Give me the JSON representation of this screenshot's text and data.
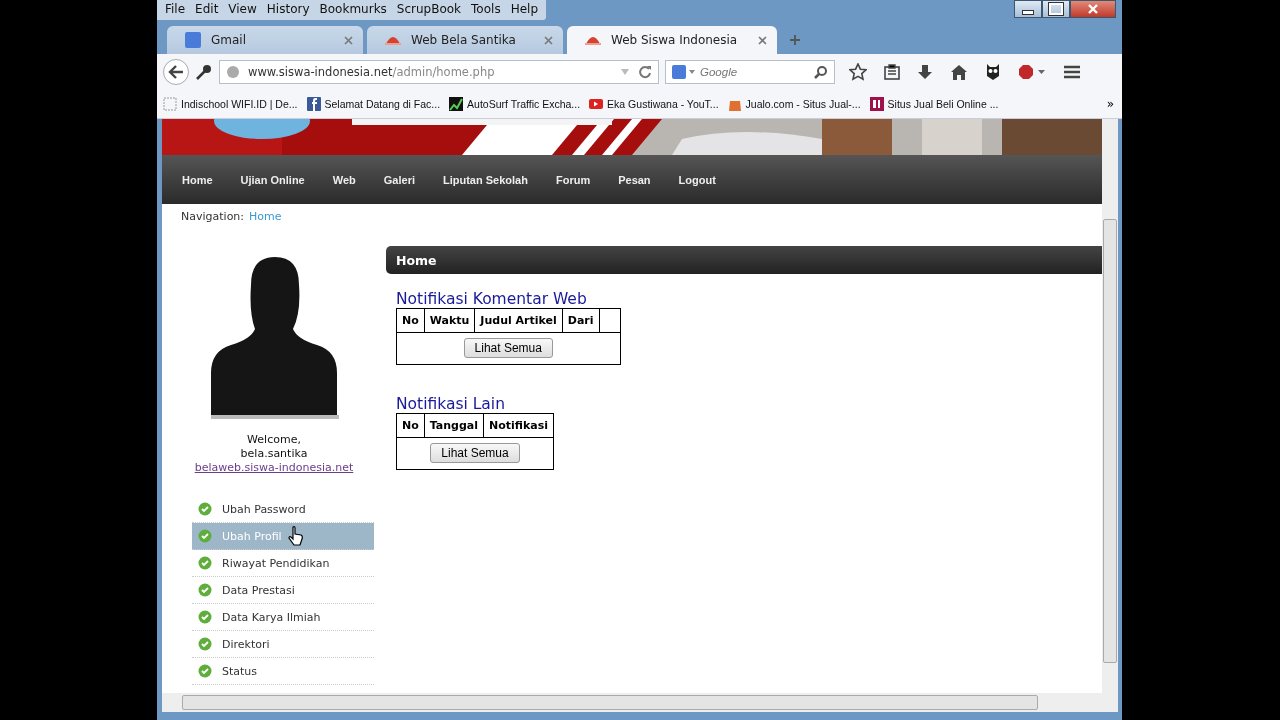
{
  "menu_bar": [
    "File",
    "Edit",
    "View",
    "History",
    "Bookmurks",
    "ScrupBook",
    "Tools",
    "Help"
  ],
  "tabs": [
    {
      "label": "Gmail",
      "kind": "google",
      "selected": false
    },
    {
      "label": "Web Bela Santika",
      "kind": "site",
      "selected": false
    },
    {
      "label": "Web Siswa Indonesia",
      "kind": "site",
      "selected": true
    }
  ],
  "address_bar": {
    "domain": "www.siswa-indonesia.net",
    "path": "/admin/home.php"
  },
  "search": {
    "placeholder": "Google"
  },
  "bookmarks": [
    {
      "label": "Indischool WIFI.ID | De...",
      "kind": "blank"
    },
    {
      "label": "Selamat Datang di Fac...",
      "kind": "facebook"
    },
    {
      "label": "AutoSurf Traffic Excha...",
      "kind": "chart"
    },
    {
      "label": "Eka Gustiwana - YouT...",
      "kind": "youtube"
    },
    {
      "label": "Jualo.com - Situs Jual-...",
      "kind": "bag"
    },
    {
      "label": "Situs Jual Beli Online ...",
      "kind": "square"
    }
  ],
  "bookmarks_overflow": "»",
  "site_nav": [
    {
      "label": "Home"
    },
    {
      "label": "Ujian Online"
    },
    {
      "label": "Web"
    },
    {
      "label": "Galeri"
    },
    {
      "label": "Liputan Sekolah"
    },
    {
      "label": "Forum"
    },
    {
      "label": "Pesan"
    },
    {
      "label": "Logout"
    }
  ],
  "breadcrumb": {
    "label": "Navigation:",
    "current": "Home"
  },
  "profile": {
    "welcome": "Welcome,",
    "username": "bela.santika",
    "link": "belaweb.siswa-indonesia.net"
  },
  "sidebar_items": [
    {
      "label": "Ubah Password",
      "selected": false
    },
    {
      "label": "Ubah Profil",
      "selected": true
    },
    {
      "label": "Riwayat Pendidikan",
      "selected": false
    },
    {
      "label": "Data Prestasi",
      "selected": false
    },
    {
      "label": "Data Karya Ilmiah",
      "selected": false
    },
    {
      "label": "Direktori",
      "selected": false
    },
    {
      "label": "Status",
      "selected": false
    }
  ],
  "panel_title": "Home",
  "sections": [
    {
      "title": "Notifikasi Komentar Web",
      "columns": [
        "No",
        "Waktu",
        "Judul Artikel",
        "Dari",
        ""
      ],
      "button": "Lihat Semua"
    },
    {
      "title": "Notifikasi Lain",
      "columns": [
        "No",
        "Tanggal",
        "Notifikasi"
      ],
      "button": "Lihat Semua"
    }
  ]
}
